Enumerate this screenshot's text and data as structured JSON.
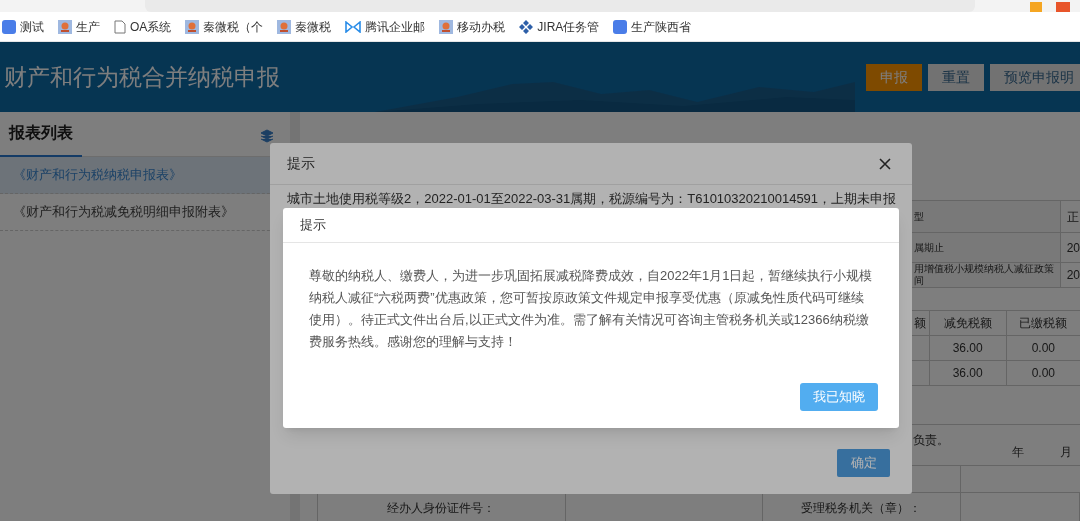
{
  "bookmarks": [
    {
      "label": "测试",
      "kind": "app"
    },
    {
      "label": "生产",
      "kind": "portrait"
    },
    {
      "label": "OA系统",
      "kind": "page"
    },
    {
      "label": "秦微税（个",
      "kind": "portrait"
    },
    {
      "label": "秦微税",
      "kind": "portrait"
    },
    {
      "label": "腾讯企业邮",
      "kind": "mail"
    },
    {
      "label": "移动办税",
      "kind": "portrait"
    },
    {
      "label": "JIRA任务管",
      "kind": "jira"
    },
    {
      "label": "生产陕西省",
      "kind": "app"
    }
  ],
  "header": {
    "title": "财产和行为税合并纳税申报",
    "buttons": [
      {
        "label": "申报",
        "kind": "primary"
      },
      {
        "label": "重置",
        "kind": "default"
      },
      {
        "label": "预览申报明",
        "kind": "default"
      }
    ]
  },
  "sidebar": {
    "title": "报表列表",
    "items": [
      {
        "label": "《财产和行为税纳税申报表》",
        "selected": true
      },
      {
        "label": "《财产和行为税减免税明细申报附表》",
        "selected": false
      }
    ]
  },
  "info_table": {
    "rows": [
      {
        "label": [
          "型"
        ],
        "value": "正"
      },
      {
        "label": [
          "属期止"
        ],
        "value": "20"
      },
      {
        "label": [
          "用增值税小规模纳税人减征政策",
          "间"
        ],
        "value": "20"
      }
    ]
  },
  "amount_table": {
    "columns": [
      "额",
      "减免税额",
      "已缴税额"
    ],
    "rows": [
      {
        "cells": [
          "",
          "36.00",
          "0.00"
        ]
      },
      {
        "cells": [
          "",
          "36.00",
          "0.00"
        ]
      }
    ]
  },
  "declaration": {
    "text": "负责。",
    "year": "年",
    "month": "月"
  },
  "signature_row": [
    "经办人身份证件号：",
    "受理税务机关（章）："
  ],
  "dialog_back": {
    "title": "提示",
    "message": "城市土地使用税等级2，2022-01-01至2022-03-31属期，税源编号为：T61010320210014591，上期未申报",
    "button": "确定"
  },
  "dialog_front": {
    "title": "提示",
    "message": "尊敬的纳税人、缴费人，为进一步巩固拓展减税降费成效，自2022年1月1日起，暂继续执行小规模纳税人减征“六税两费”优惠政策，您可暂按原政策文件规定申报享受优惠（原减免性质代码可继续使用）。待正式文件出台后,以正式文件为准。需了解有关情况可咨询主管税务机关或12366纳税缴费服务热线。感谢您的理解与支持！",
    "button": "我已知晓"
  }
}
